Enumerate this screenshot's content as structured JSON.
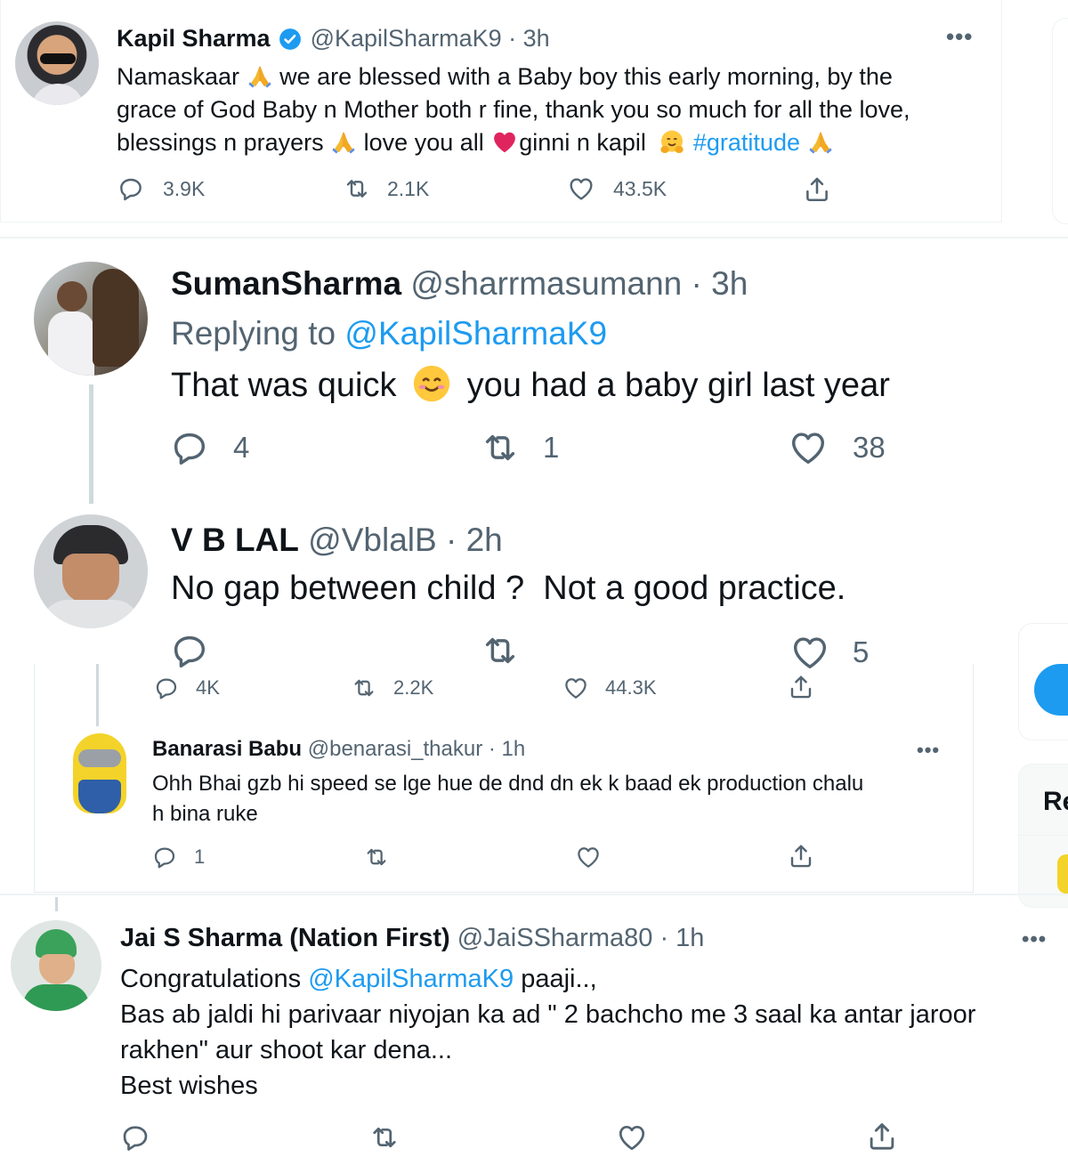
{
  "tweet1": {
    "name": "Kapil Sharma",
    "handle": "@KapilSharmaK9",
    "time": "· 3h",
    "line1_a": "Namaskaar",
    "line1_b": "we are blessed with a Baby boy this early morning, by the",
    "line2": "grace of God Baby n Mother both r fine, thank you so much for all the love,",
    "line3_a": "blessings n prayers",
    "line3_b": "love you all",
    "line3_c": "ginni n kapil",
    "hashtag": "#gratitude",
    "replies": "3.9K",
    "retweets": "2.1K",
    "likes": "43.5K"
  },
  "tweet2": {
    "name": "SumanSharma",
    "handle": "@sharrmasumann",
    "time": "· 3h",
    "replying_label": "Replying to",
    "replying_handle": "@KapilSharmaK9",
    "text_a": "That was quick",
    "text_b": "you had a baby girl last year",
    "replies": "4",
    "retweets": "1",
    "likes": "38"
  },
  "tweet3": {
    "name": "V B LAL",
    "handle": "@VblalB",
    "time": "· 2h",
    "text": "No gap between child ?  Not a good practice.",
    "likes": "5"
  },
  "bg_stats": {
    "replies": "4K",
    "retweets": "2.2K",
    "likes": "44.3K"
  },
  "tweet4": {
    "name": "Banarasi Babu",
    "handle": "@benarasi_thakur",
    "time": "· 1h",
    "line1": "Ohh Bhai gzb hi speed se lge hue de dnd dn ek k baad ek production chalu",
    "line2": "h bina ruke",
    "replies": "1"
  },
  "tweet5": {
    "name": "Jai S Sharma (Nation First)",
    "handle": "@JaiSSharma80",
    "time": "· 1h",
    "line1_a": "Congratulations",
    "line1_mention": "@KapilSharmaK9",
    "line1_b": "paaji..,",
    "line2": "Bas ab jaldi hi parivaar niyojan ka ad \" 2 bachcho me 3 saal ka antar jaroor",
    "line3": "rakhen\" aur shoot kar dena...",
    "line4": "Best wishes"
  },
  "sidebar": {
    "partial_heading": "Re"
  },
  "icons": {
    "more": "more-icon",
    "reply": "reply-icon",
    "retweet": "retweet-icon",
    "like": "like-icon",
    "share": "share-icon",
    "verified": "verified-badge-icon",
    "folded_hands": "folded-hands-emoji",
    "heart_emoji": "red-heart-emoji",
    "hug_emoji": "hugging-face-emoji",
    "smile_emoji": "smiling-face-emoji"
  },
  "colors": {
    "link": "#1d9bf0",
    "muted": "#536471",
    "text": "#0f1419"
  }
}
